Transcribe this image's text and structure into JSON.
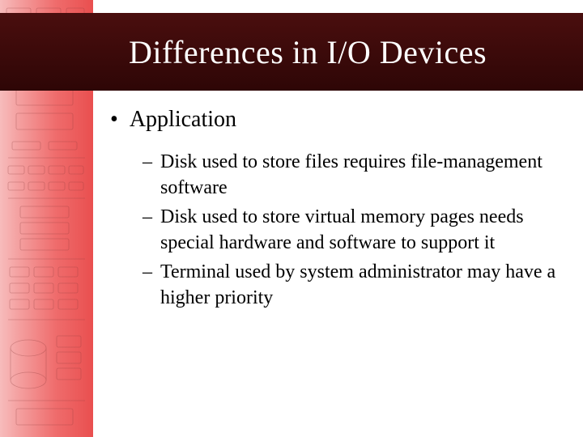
{
  "title": "Differences in I/O Devices",
  "main_bullet": "Application",
  "sub_items": [
    "Disk used to store files requires file-management software",
    "Disk used to store virtual memory pages needs special hardware and software to support it",
    "Terminal used by system administrator may have a higher priority"
  ]
}
